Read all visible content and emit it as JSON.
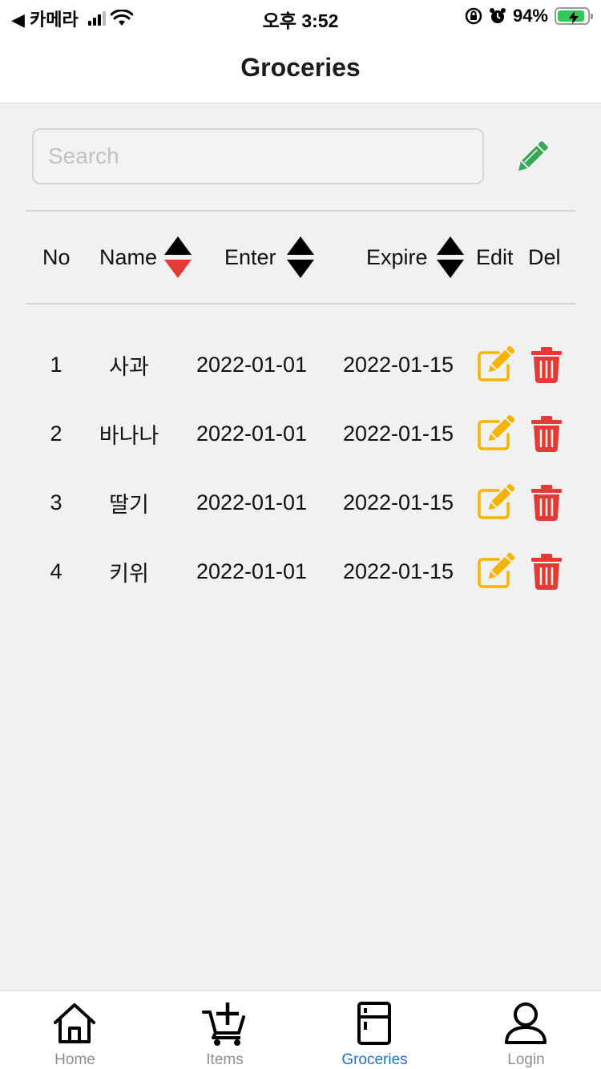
{
  "status_bar": {
    "back_label": "◀ 카메라",
    "time": "오후 3:52",
    "battery": "94%"
  },
  "header": {
    "title": "Groceries"
  },
  "search": {
    "placeholder": "Search",
    "value": ""
  },
  "table": {
    "columns": {
      "no": "No",
      "name": "Name",
      "enter": "Enter",
      "expire": "Expire",
      "edit": "Edit",
      "del": "Del"
    },
    "rows": [
      {
        "no": "1",
        "name": "사과",
        "enter": "2022-01-01",
        "expire": "2022-01-15"
      },
      {
        "no": "2",
        "name": "바나나",
        "enter": "2022-01-01",
        "expire": "2022-01-15"
      },
      {
        "no": "3",
        "name": "딸기",
        "enter": "2022-01-01",
        "expire": "2022-01-15"
      },
      {
        "no": "4",
        "name": "키위",
        "enter": "2022-01-01",
        "expire": "2022-01-15"
      }
    ]
  },
  "tabs": [
    {
      "label": "Home",
      "icon": "home-icon"
    },
    {
      "label": "Items",
      "icon": "cart-plus-icon"
    },
    {
      "label": "Groceries",
      "icon": "fridge-icon",
      "active": true
    },
    {
      "label": "Login",
      "icon": "user-icon"
    }
  ],
  "colors": {
    "add_green": "#34a853",
    "edit_yellow": "#f4b400",
    "delete_red": "#e53935",
    "sort_active_red": "#e53935",
    "tab_active_blue": "#1a73d9",
    "battery_green": "#34c759"
  }
}
